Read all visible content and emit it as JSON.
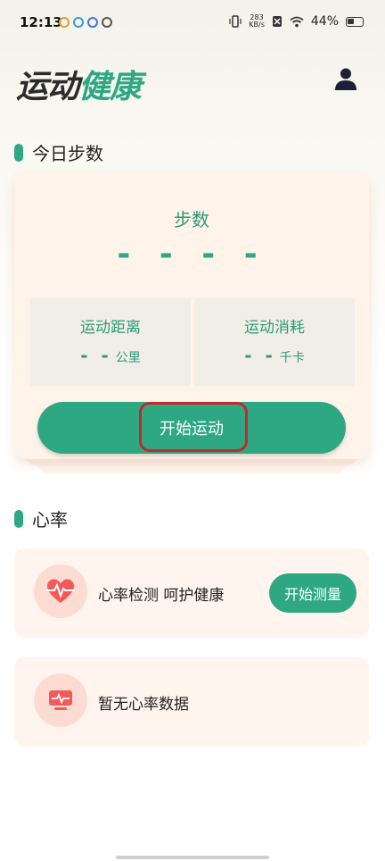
{
  "status_bar": {
    "time": "12:13",
    "speed_top": "283",
    "speed_bottom": "KB/s",
    "battery": "44%"
  },
  "header": {
    "title_part1": "运动",
    "title_part2": "健康"
  },
  "steps_section": {
    "title": "今日步数",
    "steps_label": "步数",
    "steps_value": "- - - -",
    "distance": {
      "label": "运动距离",
      "value": "- -",
      "unit": "公里"
    },
    "calories": {
      "label": "运动消耗",
      "value": "- -",
      "unit": "千卡"
    },
    "start_button": "开始运动"
  },
  "heart_section": {
    "title": "心率",
    "detect_text": "心率检测 呵护健康",
    "measure_button": "开始测量",
    "empty_text": "暂无心率数据"
  },
  "colors": {
    "accent": "#2ea883",
    "card_bg": "#fff3ea",
    "highlight": "#c8262a"
  },
  "icons": {
    "profile": "user-icon",
    "heart": "heartbeat-icon",
    "monitor": "monitor-pulse-icon"
  }
}
